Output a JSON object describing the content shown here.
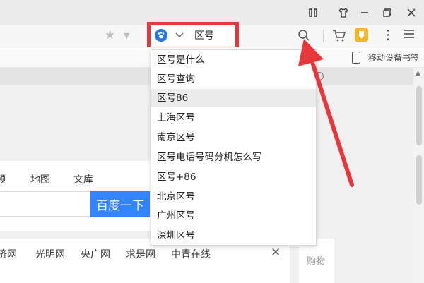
{
  "toolbar": {
    "search_engine_icon": "baidu-paw-icon",
    "query": "区号"
  },
  "bookmarks": {
    "mobile_bookmarks_label": "移动设备书签"
  },
  "suggestions": [
    "区号是什么",
    "区号查询",
    "区号86",
    "上海区号",
    "南京区号",
    "区号电话号码分机怎么写",
    "区号+86",
    "北京区号",
    "广州区号",
    "深圳区号"
  ],
  "active_suggestion_index": 2,
  "page": {
    "nav": [
      "频",
      "地图",
      "文库"
    ],
    "search_button": "百度一下",
    "news_links": [
      "济网",
      "光明网",
      "央广网",
      "求是网",
      "中青在线"
    ],
    "shop_label": "购物"
  },
  "colors": {
    "highlight_red": "#e8373b",
    "baidu_blue": "#3385ff",
    "shield_yellow": "#f4b52a"
  }
}
